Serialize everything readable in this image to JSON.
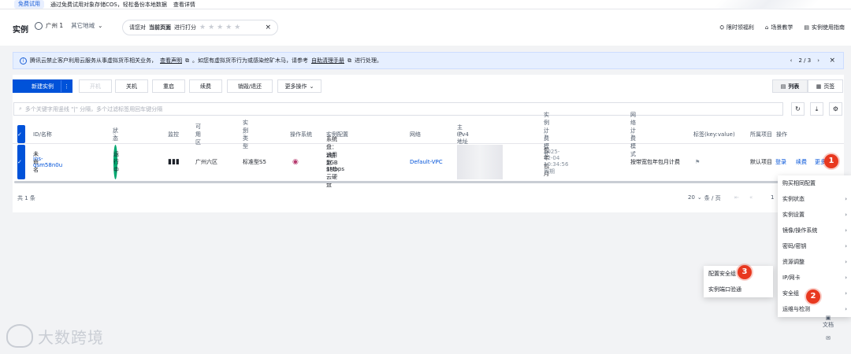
{
  "topbar": {
    "tag": "免费试用",
    "text": "通过免费试用对象存储COS，轻松备份本地数据",
    "more": "查看详情"
  },
  "header": {
    "title": "实例",
    "region": "广州 1",
    "other_region": "其它地域",
    "rate_prompt": "请您对",
    "rate_target": "当前页面",
    "rate_action": "进行打分",
    "stars": "★★★★★",
    "links": [
      "限时领福利",
      "场景教学",
      "实例使用指南"
    ]
  },
  "notice": {
    "text1": "腾讯云禁止客户利用云服务从事虚拟货币相关业务，",
    "link1": "查看声明",
    "text2": "。如您有虚拟货币行为或感染挖矿木马，请参考",
    "link2": "自助清理手册",
    "text3": "进行处理。",
    "pager": "2 / 3"
  },
  "toolbar": {
    "new_instance": "新建实例",
    "buttons": [
      "开机",
      "关机",
      "重启",
      "续费",
      "销毁/退还",
      "更多操作"
    ],
    "view_list": "列表",
    "view_page": "页签",
    "search_placeholder": "多个关键字用竖线 \"|\" 分隔，多个过滤标签用回车键分隔"
  },
  "table": {
    "headers": [
      "ID/名称",
      "状态",
      "监控",
      "可用区",
      "实例类型",
      "操作系统",
      "实例配置",
      "网络",
      "主IPv4地址",
      "实例计费模式",
      "网络计费模式",
      "标签(key:value)",
      "所属项目",
      "操作"
    ],
    "row": {
      "id": "ins-qsm58n0u",
      "name": "未命名",
      "status": "运行中",
      "zone": "广州六区",
      "type": "标准型S5",
      "config1": "2核 2GB 3Mbps",
      "config2": "系统盘：通用型SSD云硬盘",
      "network": "Default-VPC",
      "billing1": "包年包月",
      "billing2": "2025-12-04 10:34:56 到期",
      "net_billing": "按带宽包年包月计费",
      "project": "默认项目",
      "op_login": "登录",
      "op_renew": "续费",
      "op_more": "更多"
    }
  },
  "footer": {
    "total": "共 1 条",
    "page_size": "20",
    "page_size_unit": "条 / 页",
    "page": "1"
  },
  "more_menu": {
    "items": [
      "购买相同配置",
      "实例状态",
      "实例设置",
      "镜像/操作系统",
      "密码/密钥",
      "资源调整",
      "IP/网卡",
      "安全组",
      "运维与检测"
    ]
  },
  "sg_menu": {
    "items": [
      "配置安全组",
      "实例端口验通"
    ]
  },
  "markers": [
    "1",
    "2",
    "3"
  ],
  "watermark": "大数跨境",
  "side_tools": {
    "doc": "文档"
  }
}
